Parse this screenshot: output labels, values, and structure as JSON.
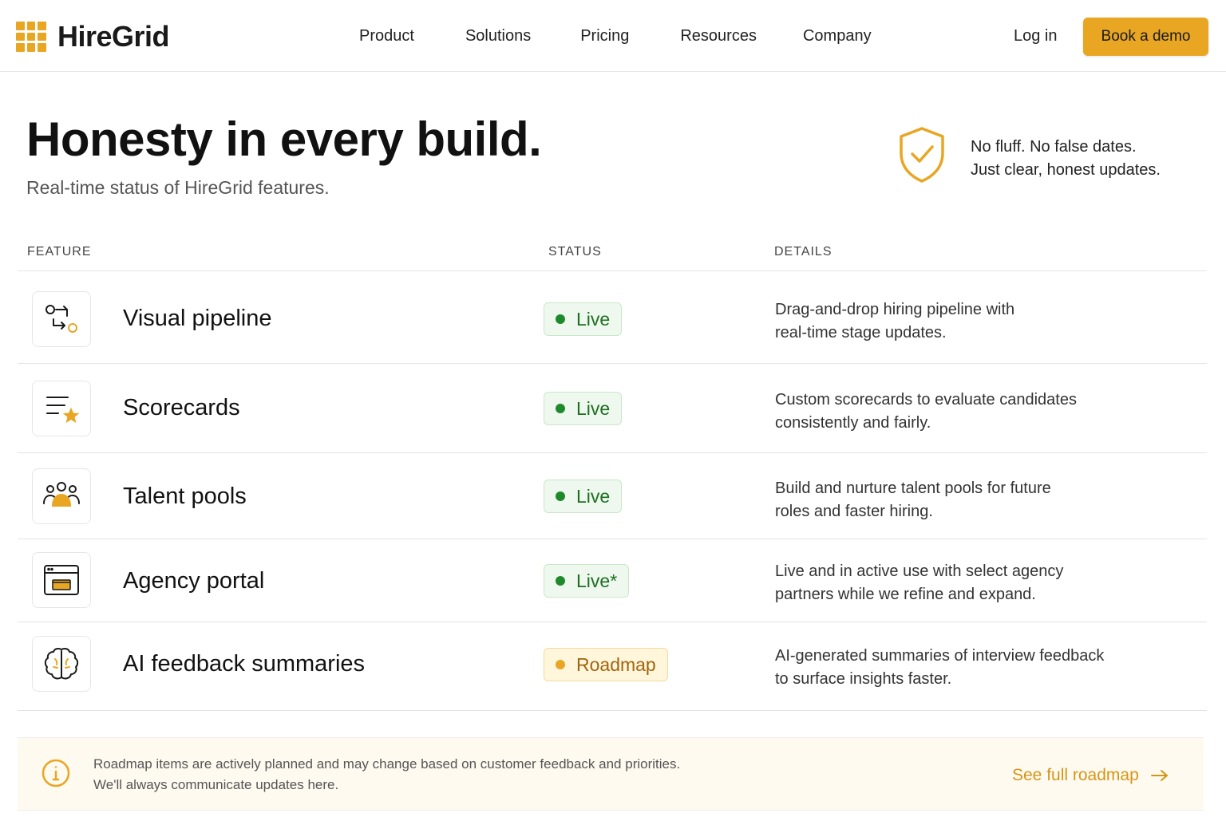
{
  "brand": {
    "name": "HireGrid"
  },
  "nav": {
    "links": [
      "Product",
      "Solutions",
      "Pricing",
      "Resources",
      "Company"
    ],
    "login": "Log in",
    "cta": "Book a demo"
  },
  "hero": {
    "title": "Honesty in every build.",
    "subtitle": "Real-time status of HireGrid features.",
    "promise_line1": "No fluff. No false dates.",
    "promise_line2": "Just clear, honest updates."
  },
  "table": {
    "headers": {
      "feature": "FEATURE",
      "status": "STATUS",
      "details": "DETAILS"
    },
    "rows": [
      {
        "icon": "pipeline-icon",
        "name": "Visual pipeline",
        "status": "Live",
        "status_type": "live",
        "details_line1": "Drag-and-drop hiring pipeline with",
        "details_line2": "real-time stage updates."
      },
      {
        "icon": "scorecard-icon",
        "name": "Scorecards",
        "status": "Live",
        "status_type": "live",
        "details_line1": "Custom scorecards to evaluate candidates",
        "details_line2": "consistently and fairly."
      },
      {
        "icon": "talent-pools-icon",
        "name": "Talent pools",
        "status": "Live",
        "status_type": "live",
        "details_line1": "Build and nurture talent pools for future",
        "details_line2": "roles and faster hiring."
      },
      {
        "icon": "portal-window-icon",
        "name": "Agency portal",
        "status": "Live*",
        "status_type": "live",
        "details_line1": "Live and in active use with select agency",
        "details_line2": "partners while we refine and expand."
      },
      {
        "icon": "ai-brain-icon",
        "name": "AI feedback summaries",
        "status": "Roadmap",
        "status_type": "roadmap",
        "details_line1": "AI-generated summaries of interview feedback",
        "details_line2": "to surface insights faster."
      }
    ]
  },
  "note": {
    "line1": "Roadmap items are actively planned and may change based on customer feedback and priorities.",
    "line2": "We'll always communicate updates here.",
    "link": "See full roadmap"
  },
  "colors": {
    "accent": "#e8a623",
    "live_green": "#1f8a2c",
    "roadmap_amber": "#a0650c"
  }
}
